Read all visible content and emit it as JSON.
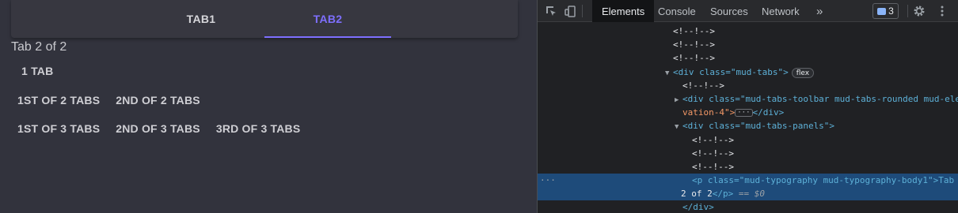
{
  "app": {
    "tabs": [
      {
        "label": "TAB1",
        "active": false
      },
      {
        "label": "TAB2",
        "active": true
      }
    ],
    "accent_color": "#7e6fff",
    "panel_text": "Tab 2 of 2",
    "button_rows": [
      [
        "1 TAB"
      ],
      [
        "1ST OF 2 TABS",
        "2ND OF 2 TABS"
      ],
      [
        "1ST OF 3 TABS",
        "2ND OF 3 TABS",
        "3RD OF 3 TABS"
      ]
    ]
  },
  "devtools": {
    "tabs": [
      "Elements",
      "Console",
      "Sources",
      "Network"
    ],
    "active_tab": "Elements",
    "more_tabs_glyph": "»",
    "issues_count": "3",
    "icons": [
      "inspect-element-icon",
      "device-toggle-icon",
      "issues-icon",
      "settings-gear-icon",
      "kebab-menu-icon"
    ],
    "dom": {
      "comment": "<!--!-->",
      "div_open": "<div class=\"mud-tabs\">",
      "flex_pill": "flex",
      "toolbar_line1": "<div class=\"mud-tabs-toolbar mud-tabs-rounded mud-ele",
      "toolbar_line2": "vation-4\">",
      "toolbar_close": "</div>",
      "panels_open": "<div class=\"mud-tabs-panels\">",
      "p_line1": "<p class=\"mud-typography mud-typography-body1\">Tab",
      "p_line2_text": "2 of 2",
      "p_close": "</p>",
      "selected_marker": "== $0",
      "div_close": "</div>",
      "ellipsis": "···"
    }
  }
}
